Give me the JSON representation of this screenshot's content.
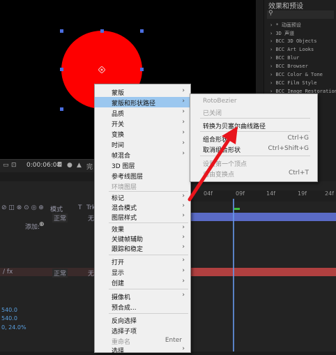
{
  "viewer": {
    "timecode": "0:00:06:08",
    "toolbar_trailing_label": "完",
    "circle_color": "#fe0000",
    "handle_color": "#4a6ee0"
  },
  "effects_panel": {
    "title": "效果和预设",
    "search_placeholder": "",
    "items": [
      "* 动画预设",
      "3D 声道",
      "BCC 3D Objects",
      "BCC Art Looks",
      "BCC Blur",
      "BCC Browser",
      "BCC Color & Tone",
      "BCC Film Style",
      "BCC Image Restoration"
    ]
  },
  "timeline": {
    "ticks": [
      "04f",
      "09f",
      "14f",
      "19f",
      "24f"
    ],
    "mode_header": "模式",
    "t_header": "T",
    "trk_header": "Trk",
    "layer1_mode": "正常",
    "layer2_mode": "正常",
    "none_label_1": "无",
    "none_label_2": "无",
    "add_label": "添加:",
    "values": [
      "540.0",
      "540.0",
      "0, 24.0%"
    ],
    "bar_blue_color": "#5a6bc6",
    "bar_red_color": "#b04040"
  },
  "context_menu": {
    "items": [
      {
        "label": "蒙版",
        "arrow": true
      },
      {
        "label": "蒙版和形状路径",
        "arrow": true,
        "selected": true
      },
      {
        "label": "品质",
        "arrow": true
      },
      {
        "label": "开关",
        "arrow": true
      },
      {
        "label": "变换",
        "arrow": true
      },
      {
        "label": "时间",
        "arrow": true
      },
      {
        "label": "帧混合",
        "arrow": true
      },
      {
        "label": "3D 图层"
      },
      {
        "label": "参考线图层"
      },
      {
        "label": "环境图层",
        "disabled": true
      },
      {
        "label": "标记",
        "arrow": true
      },
      {
        "label": "混合模式",
        "arrow": true
      },
      {
        "label": "图层样式",
        "arrow": true
      },
      {
        "label": "效果",
        "arrow": true
      },
      {
        "label": "关键帧辅助",
        "arrow": true
      },
      {
        "label": "跟踪和稳定",
        "arrow": true
      },
      {
        "label": "打开",
        "arrow": true
      },
      {
        "label": "显示",
        "arrow": true
      },
      {
        "label": "创建",
        "arrow": true
      },
      {
        "label": "摄像机",
        "arrow": true
      },
      {
        "label": "预合成..."
      },
      {
        "label": "反向选择"
      },
      {
        "label": "选择子项"
      },
      {
        "label": "重命名",
        "shortcut": "Enter",
        "disabled": true
      },
      {
        "label": "选择",
        "arrow": true
      }
    ]
  },
  "submenu": {
    "items": [
      {
        "label": "RotoBezier",
        "disabled": true
      },
      {
        "label": "已关闭",
        "disabled": true
      },
      {
        "label": "转换为贝塞尔曲线路径"
      },
      {
        "label": "组合形状",
        "shortcut": "Ctrl+G"
      },
      {
        "label": "取消组合形状",
        "shortcut": "Ctrl+Shift+G"
      },
      {
        "label": "设置第一个顶点",
        "disabled": true
      },
      {
        "label": "自由变换点",
        "shortcut": "Ctrl+T",
        "disabled": true
      }
    ]
  },
  "annotation": {
    "arrow_color": "#e8141c"
  }
}
